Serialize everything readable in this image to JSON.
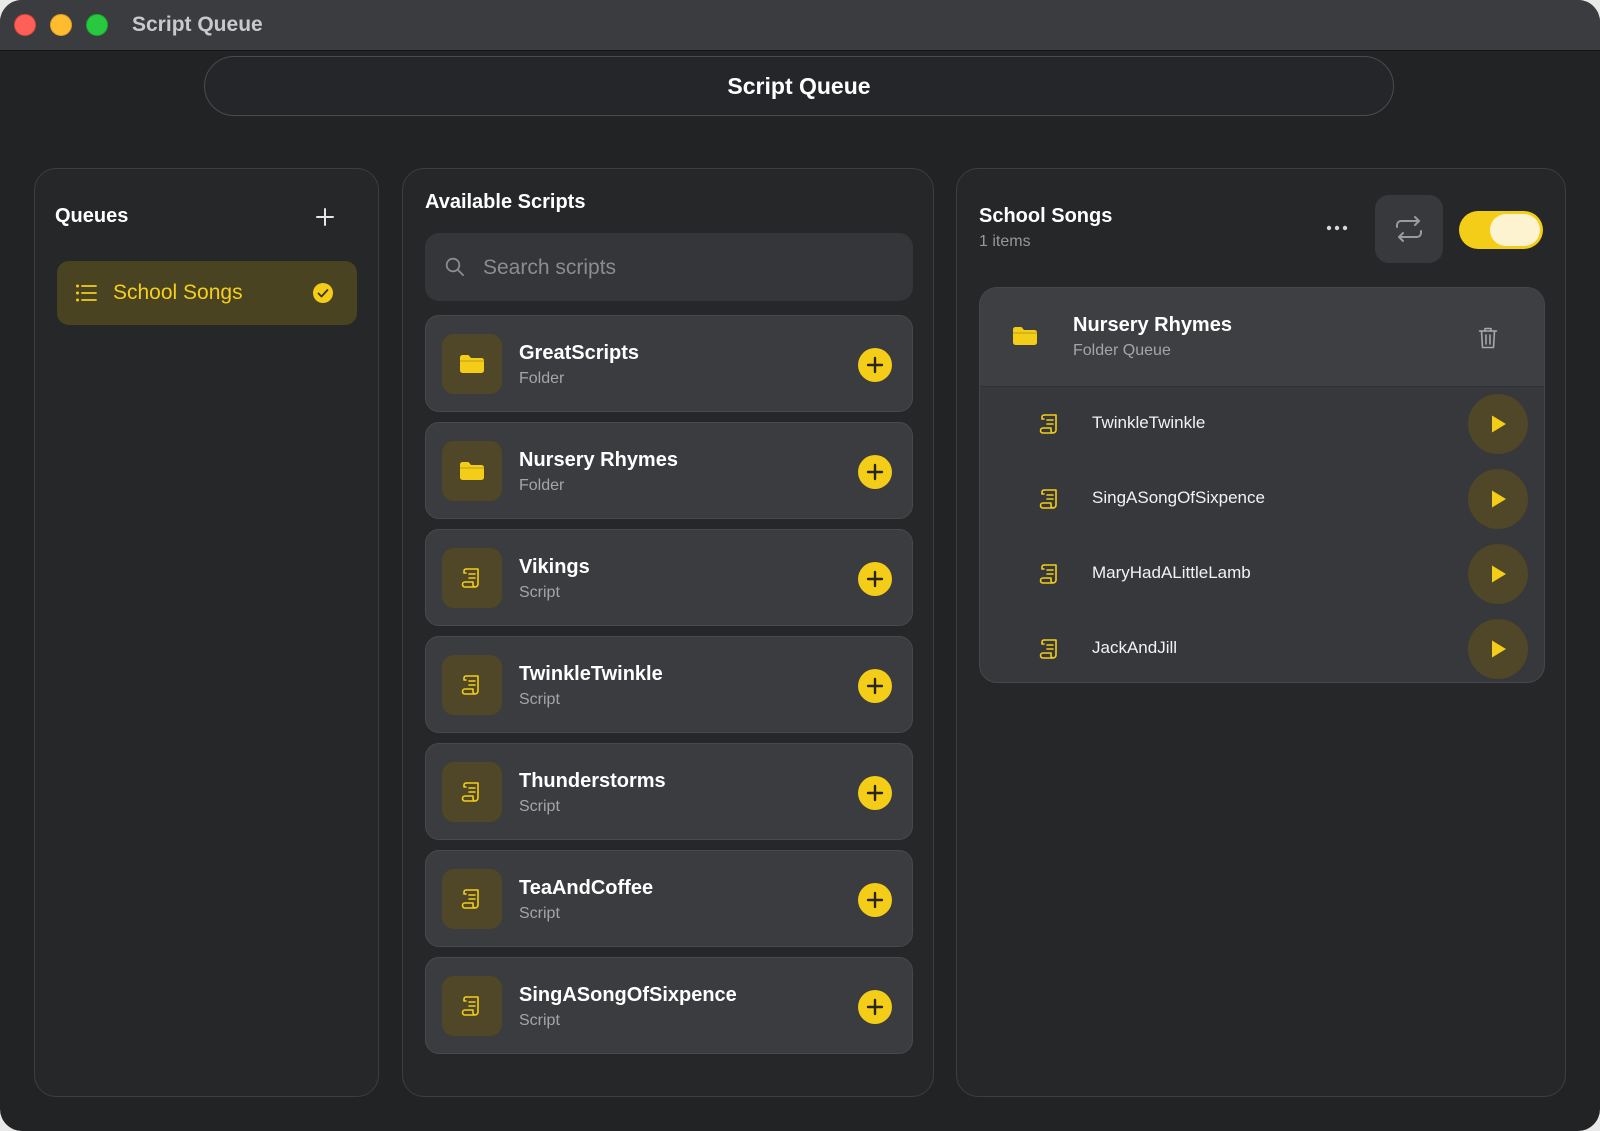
{
  "window": {
    "title": "Script Queue"
  },
  "header": {
    "title": "Script Queue"
  },
  "queues": {
    "heading": "Queues",
    "items": [
      {
        "label": "School Songs",
        "selected": true
      }
    ]
  },
  "scripts": {
    "heading": "Available Scripts",
    "search_placeholder": "Search scripts",
    "items": [
      {
        "name": "GreatScripts",
        "kind": "Folder",
        "icon": "folder-icon"
      },
      {
        "name": "Nursery Rhymes",
        "kind": "Folder",
        "icon": "folder-icon"
      },
      {
        "name": "Vikings",
        "kind": "Script",
        "icon": "scroll-icon"
      },
      {
        "name": "TwinkleTwinkle",
        "kind": "Script",
        "icon": "scroll-icon"
      },
      {
        "name": "Thunderstorms",
        "kind": "Script",
        "icon": "scroll-icon"
      },
      {
        "name": "TeaAndCoffee",
        "kind": "Script",
        "icon": "scroll-icon"
      },
      {
        "name": "SingASongOfSixpence",
        "kind": "Script",
        "icon": "scroll-icon"
      }
    ]
  },
  "detail": {
    "title": "School Songs",
    "count": "1 items",
    "repeat_enabled": true,
    "folder": {
      "title": "Nursery Rhymes",
      "subtitle": "Folder Queue",
      "items": [
        {
          "name": "TwinkleTwinkle"
        },
        {
          "name": "SingASongOfSixpence"
        },
        {
          "name": "MaryHadALittleLamb"
        },
        {
          "name": "JackAndJill"
        }
      ]
    }
  },
  "colors": {
    "accent": "#f3cd18",
    "background": "#222325",
    "card": "#3b3c3f"
  }
}
